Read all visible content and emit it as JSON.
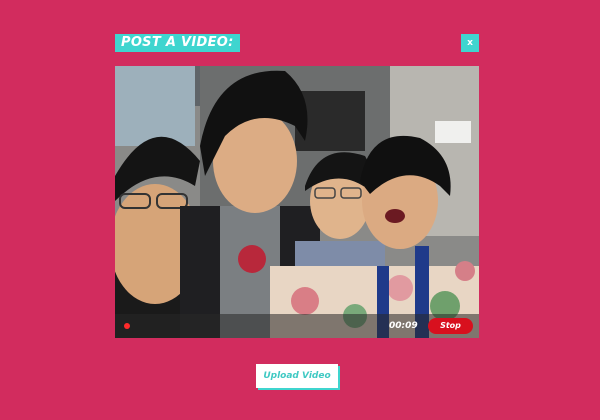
{
  "modal": {
    "title": "POST A VIDEO:",
    "close_label": "x"
  },
  "video": {
    "timer": "00:09",
    "stop_label": "Stop",
    "recording": true
  },
  "actions": {
    "upload_label": "Upload Video"
  },
  "colors": {
    "background": "#d22c5e",
    "accent": "#3fd5cf",
    "stop": "#d8101e",
    "rec_dot": "#ff2a2a"
  }
}
